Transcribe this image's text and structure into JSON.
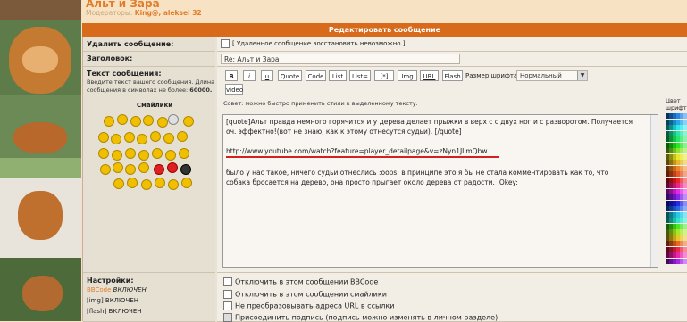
{
  "forum": {
    "title": "Альт и Зара",
    "moderators_label": "Модераторы:",
    "moderators": "King@, aleksei 32"
  },
  "panel": {
    "heading": "Редактировать сообщение"
  },
  "delete": {
    "label": "Удалить сообщение:",
    "note": "[ Удаленное сообщение восстановить невозможно ]"
  },
  "subject": {
    "label": "Заголовок:",
    "value": "Re: Альт и Зара"
  },
  "body": {
    "label": "Текст сообщения:",
    "hint": "Введите текст вашего сообщения. Длина сообщения в символах не более:",
    "max_len": "60000.",
    "tip": "Совет: можно быстро применить стили к выделенному тексту.",
    "line1": "[quote]Альт правда немного горячится и у дерева делает прыжки в верх с с двух ног и с разворотом. Получается",
    "line2": "оч. эффектно!(вот не знаю, как к этому отнесутся судьи). [/quote]",
    "url": "http://www.youtube.com/watch?feature=player_detailpage&v=zNyn1JLmQbw",
    "line4": "было у нас такое, ничего судьи отнеслись :oops:  в принципе это я бы не стала комментировать как то, что",
    "line5": "собака бросается на дерево, она просто прыгает около дерева от радости. :Okey:"
  },
  "toolbar": {
    "buttons": [
      "B",
      "i",
      "u",
      "Quote",
      "Code",
      "List",
      "List=",
      "[*]",
      "Img",
      "URL",
      "Flash"
    ],
    "video": "video",
    "font_size_label": "Размер шрифта:",
    "font_size_value": "Нормальный"
  },
  "smilies": {
    "label": "Смайлики"
  },
  "colors": {
    "label": "Цвет шрифта"
  },
  "settings": {
    "label": "Настройки:",
    "bbcode_name": "BBCode",
    "bbcode_state": "ВКЛЮЧЕН",
    "img": "[img] ВКЛЮЧЕН",
    "flash": "[flash] ВКЛЮЧЕН"
  },
  "options": [
    "Отключить в этом сообщении BBCode",
    "Отключить в этом сообщении смайлики",
    "Не преобразовывать адреса URL в ссылки",
    "Присоединить подпись (подпись можно изменять в личном разделе)"
  ],
  "accent": "#d86a1c"
}
